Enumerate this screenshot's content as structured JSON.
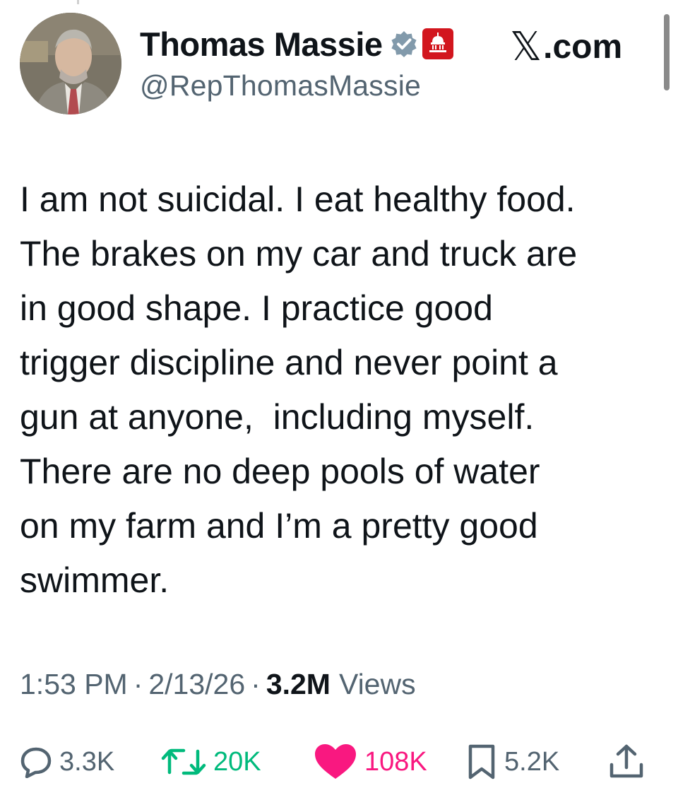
{
  "author": {
    "display_name": "Thomas Massie",
    "handle": "@RepThomasMassie",
    "avatar_icon": "profile-photo",
    "verified_icon": "verified-badge-icon",
    "affiliation_icon": "capitol-dome-badge-icon"
  },
  "site": {
    "logo_glyph": "𝕏",
    "label": ".com"
  },
  "tweet": {
    "text": "I am not suicidal. I eat healthy food.\nThe brakes on my car and truck are\nin good shape. I practice good\ntrigger discipline and never point a\ngun at anyone,  including myself.\nThere are no deep pools of water\non my farm and I’m a pretty good\nswimmer."
  },
  "meta": {
    "time": "1:53 PM",
    "separator": "·",
    "date": "2/13/26",
    "views_count": "3.2M",
    "views_label": "Views"
  },
  "actions": {
    "replies": "3.3K",
    "retweets": "20K",
    "likes": "108K",
    "bookmarks": "5.2K"
  },
  "colors": {
    "text": "#0f1419",
    "secondary": "#536471",
    "retweet": "#00ba7c",
    "like": "#f91880",
    "verified": "#829aab",
    "badge": "#d2161e"
  }
}
